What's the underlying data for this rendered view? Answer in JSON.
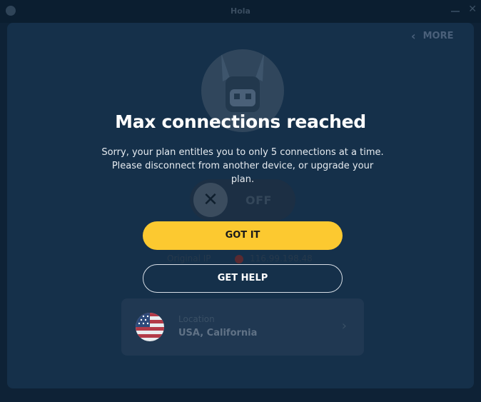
{
  "window": {
    "title": "Hola",
    "app_icon": "hola-icon",
    "controls": [
      "minimize-icon",
      "close-icon"
    ]
  },
  "header": {
    "more_label": "MORE",
    "more_icon": "chevron-left-icon"
  },
  "main": {
    "mascot_icon": "mascot-icon",
    "toggle": {
      "state_label": "OFF",
      "icon": "close-icon"
    },
    "ip": {
      "label": "Original IP",
      "value": "116.99.198.48",
      "flag_icon": "flag-icon"
    },
    "location": {
      "label": "Location",
      "value": "USA, California",
      "flag_icon": "us-flag-icon",
      "chevron_icon": "chevron-right-icon"
    }
  },
  "modal": {
    "title": "Max connections reached",
    "message": "Sorry, your plan entitles you to only 5 connections at a time. Please disconnect from another device, or upgrade your plan.",
    "primary_button": "GOT IT",
    "secondary_button": "GET HELP"
  },
  "colors": {
    "background": "#0e2236",
    "panel": "#15304a",
    "accent": "#fcc930",
    "text": "#ffffff"
  }
}
